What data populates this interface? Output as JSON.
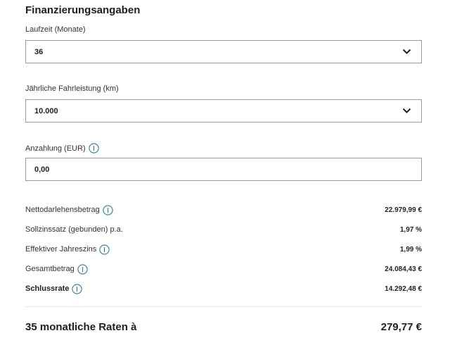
{
  "section": {
    "title": "Finanzierungsangaben"
  },
  "fields": {
    "laufzeit": {
      "label": "Laufzeit (Monate)",
      "value": "36"
    },
    "fahrleistung": {
      "label": "Jährliche Fahrleistung (km)",
      "value": "10.000"
    },
    "anzahlung": {
      "label": "Anzahlung (EUR)",
      "value": "0,00"
    }
  },
  "summary": [
    {
      "label": "Nettodarlehensbetrag",
      "value": "22.979,99 €"
    },
    {
      "label": "Sollzinssatz (gebunden) p.a.",
      "value": "1,97 %"
    },
    {
      "label": "Effektiver Jahreszins",
      "value": "1,99 %"
    },
    {
      "label": "Gesamtbetrag",
      "value": "24.084,43 €"
    },
    {
      "label": "Schlussrate",
      "value": "14.292,48 €"
    }
  ],
  "total": {
    "label": "35 monatliche Raten à",
    "value": "279,77 €"
  },
  "colors": {
    "info_icon": "#2e7d8c",
    "border": "#9a9a9a"
  },
  "icons": {
    "dropdown": "chevron-down-icon",
    "info": "info-icon"
  }
}
